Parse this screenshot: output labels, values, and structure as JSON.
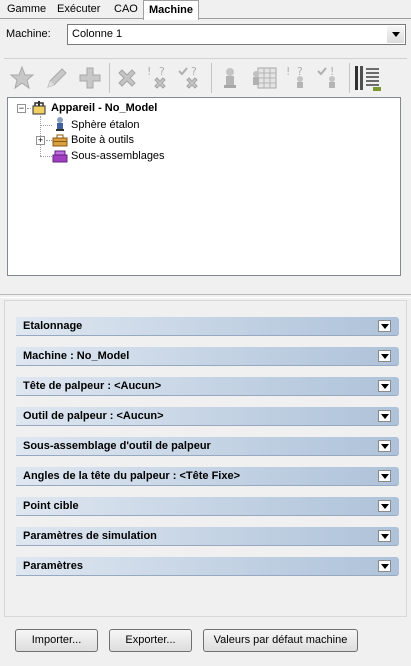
{
  "tabs": [
    {
      "label": "Gamme"
    },
    {
      "label": "Exécuter"
    },
    {
      "label": "CAO"
    },
    {
      "label": "Machine"
    }
  ],
  "machine": {
    "label": "Machine:",
    "selected": "Colonne 1"
  },
  "toolbar": {
    "icons": [
      "star-icon",
      "pencil-icon",
      "plus-icon",
      "delete-icon",
      "question-delete-icon",
      "check-delete-icon",
      "probe-icon",
      "calibration-grid-icon",
      "question-probe-icon",
      "check-probe-icon",
      "list-icon"
    ]
  },
  "tree": {
    "root": {
      "label": "Appareil - No_Model"
    },
    "children": [
      {
        "label": "Sphère étalon"
      },
      {
        "label": "Boite à outils"
      },
      {
        "label": "Sous-assemblages"
      }
    ]
  },
  "sections": [
    {
      "label": "Etalonnage"
    },
    {
      "label": "Machine : No_Model"
    },
    {
      "label": "Tête de palpeur : <Aucun>"
    },
    {
      "label": "Outil de palpeur : <Aucun>"
    },
    {
      "label": "Sous-assemblage d'outil de palpeur"
    },
    {
      "label": "Angles de la tête du palpeur : <Tête Fixe>"
    },
    {
      "label": "Point cible"
    },
    {
      "label": "Paramètres de simulation"
    },
    {
      "label": "Paramètres"
    }
  ],
  "buttons": {
    "import": "Importer...",
    "export": "Exporter...",
    "defaults": "Valeurs par défaut machine"
  },
  "colors": {
    "section_gradient_start": "#dfe7f1",
    "section_gradient_end": "#aec2d9",
    "tree_background": "#ffffff",
    "window_background": "#f0f0f0"
  }
}
